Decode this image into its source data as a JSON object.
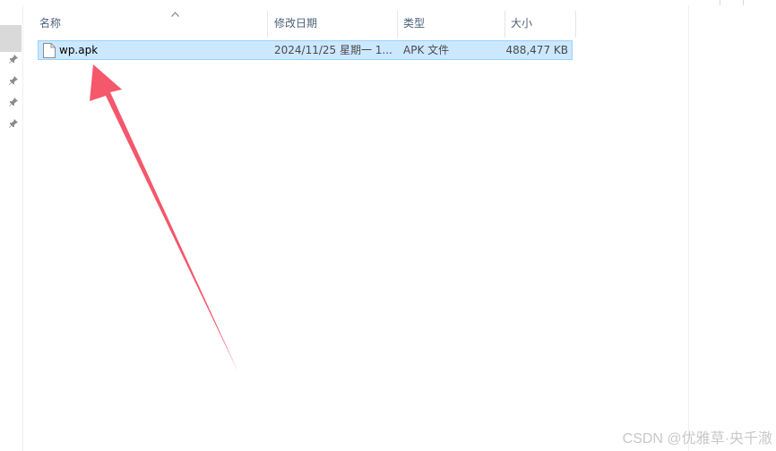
{
  "columns": {
    "name": "名称",
    "date": "修改日期",
    "type": "类型",
    "size": "大小"
  },
  "files": [
    {
      "name": "wp.apk",
      "date": "2024/11/25 星期一 1...",
      "type": "APK 文件",
      "size": "488,477 KB",
      "icon": "file-icon",
      "selected": true
    }
  ],
  "nav": {
    "pins": [
      "pin-icon",
      "pin-icon",
      "pin-icon",
      "pin-icon"
    ]
  },
  "annotation": {
    "arrow_color": "#f5576b"
  },
  "colors": {
    "selection_bg": "#cce8ff",
    "selection_border": "#99d1ff",
    "header_text": "#4c607a"
  },
  "watermark": "CSDN @优雅草·央千澈"
}
